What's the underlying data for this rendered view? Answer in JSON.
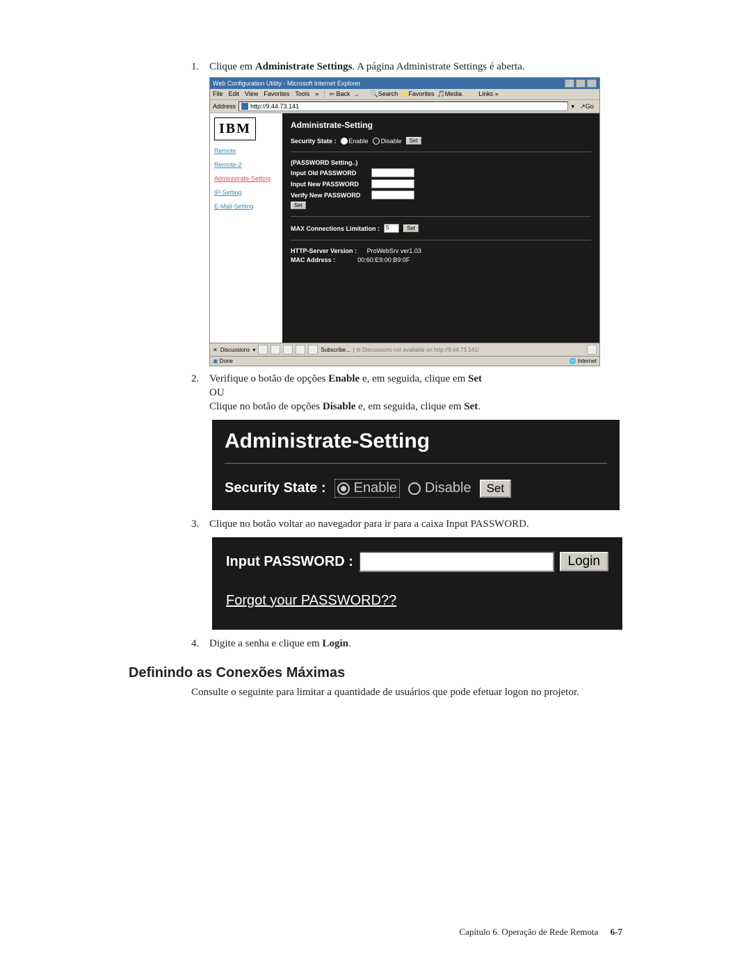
{
  "steps": {
    "s1_pre": "Clique em ",
    "s1_bold": "Administrate Settings",
    "s1_post": ". A página Administrate Settings é aberta.",
    "s2_pre": "Verifique o botão de opções ",
    "s2_b1": "Enable",
    "s2_mid": " e, em seguida, clique em ",
    "s2_b2": "Set",
    "s2_ou": "OU",
    "s2b_pre": "Clique no botão de opções ",
    "s2b_b1": "Disable",
    "s2b_mid": " e, em seguida, clique em ",
    "s2b_b2": "Set",
    "s2b_post": ".",
    "s3": "Clique no botão voltar ao navegador para ir para a caixa Input PASSWORD.",
    "s4_pre": "Digite a senha e clique em ",
    "s4_b": "Login",
    "s4_post": "."
  },
  "ie": {
    "title": "Web Configuration Utility - Microsoft Internet Explorer",
    "menu": [
      "File",
      "Edit",
      "View",
      "Favorites",
      "Tools"
    ],
    "back": "Back",
    "search": "Search",
    "favorites": "Favorites",
    "media": "Media",
    "links": "Links",
    "address_label": "Address",
    "address": "http://9.44.73.141",
    "go": "Go",
    "nav": {
      "remote": "Remote",
      "remote2": "Remote-2",
      "admin": "Administrate-Setting",
      "ip": "IP-Setting",
      "email": "E-Mail-Setting"
    },
    "main": {
      "heading": "Administrate-Setting",
      "security_label": "Security State :",
      "enable": "Enable",
      "disable": "Disable",
      "set": "Set",
      "pw_heading": "(PASSWORD Setting..)",
      "pw_old": "Input Old PASSWORD",
      "pw_new": "Input New PASSWORD",
      "pw_verify": "Verify New PASSWORD",
      "max_label": "MAX Connections Limitation :",
      "max_value": "5",
      "http_label": "HTTP-Server Version :",
      "http_value": "ProWebSrv ver1.03",
      "mac_label": "MAC Address :",
      "mac_value": "00:60:E9:00:B9:0F"
    },
    "discussions_label": "Discussions",
    "subscribe": "Subscribe...",
    "discussions_msg": "Discussions not available on http://9.44.73.141/",
    "status_done": "Done",
    "status_zone": "Internet"
  },
  "zoom_admin": {
    "title": "Administrate-Setting",
    "sec_label": "Security State :",
    "enable": "Enable",
    "disable": "Disable",
    "set": "Set"
  },
  "login": {
    "label": "Input PASSWORD :",
    "button": "Login",
    "forgot": "Forgot your PASSWORD??"
  },
  "section_heading": "Definindo as Conexões Máximas",
  "section_para": "Consulte o seguinte para limitar a quantidade de usuários que pode efetuar logon no projetor.",
  "footer": {
    "chapter": "Capítulo 6. Operação de Rede Remota",
    "page": "6-7"
  }
}
